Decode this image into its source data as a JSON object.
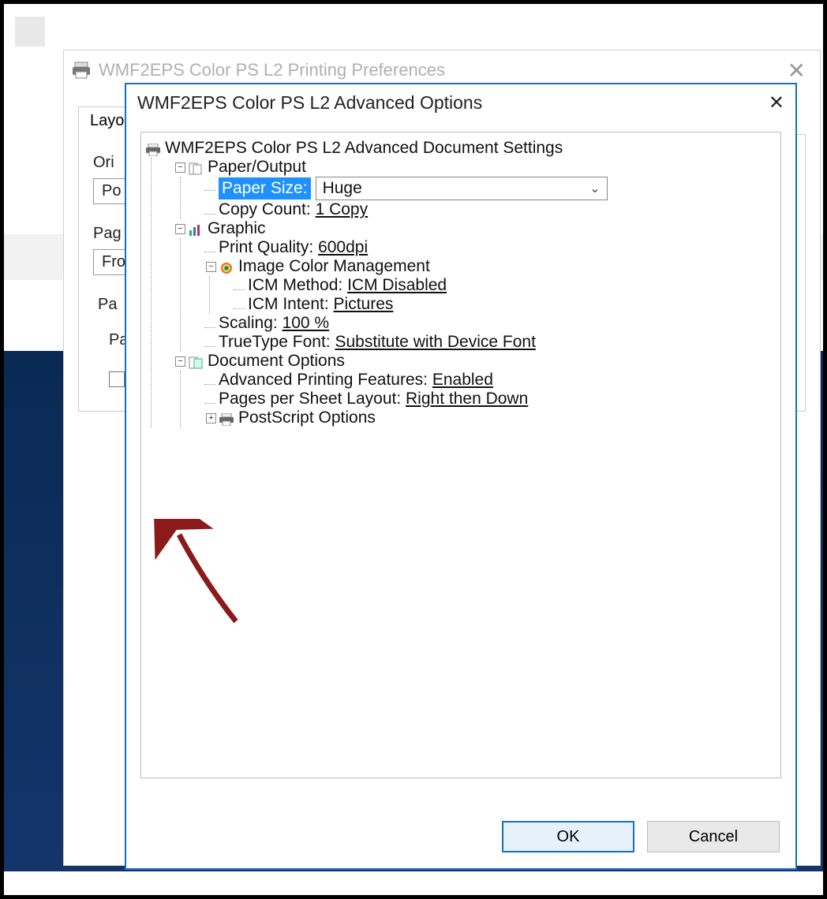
{
  "parent": {
    "title": "WMF2EPS Color PS L2 Printing Preferences",
    "tab": "Layo",
    "labels": {
      "ori": "Ori",
      "oriValue": "Po",
      "page": "Pag",
      "pageValue": "Fro",
      "pa1": "Pa",
      "pa2": "Pa"
    }
  },
  "child": {
    "title": "WMF2EPS Color PS L2 Advanced Options",
    "root": "WMF2EPS Color PS L2 Advanced Document Settings",
    "paperOutput": {
      "label": "Paper/Output",
      "paperSizeKey": "Paper Size:",
      "paperSizeValue": "Huge",
      "copyCountKey": "Copy Count:",
      "copyCountValue": "1 Copy"
    },
    "graphic": {
      "label": "Graphic",
      "printQualityKey": "Print Quality:",
      "printQualityValue": "600dpi",
      "icm": {
        "label": "Image Color Management",
        "methodKey": "ICM Method:",
        "methodValue": "ICM Disabled",
        "intentKey": "ICM Intent:",
        "intentValue": "Pictures"
      },
      "scalingKey": "Scaling:",
      "scalingValue": "100 %",
      "ttfKey": "TrueType Font:",
      "ttfValue": "Substitute with Device Font"
    },
    "docOptions": {
      "label": "Document Options",
      "advPrintKey": "Advanced Printing Features:",
      "advPrintValue": "Enabled",
      "pagesSheetKey": "Pages per Sheet Layout:",
      "pagesSheetValue": "Right then Down",
      "psOptions": "PostScript Options"
    },
    "buttons": {
      "ok": "OK",
      "cancel": "Cancel"
    }
  }
}
